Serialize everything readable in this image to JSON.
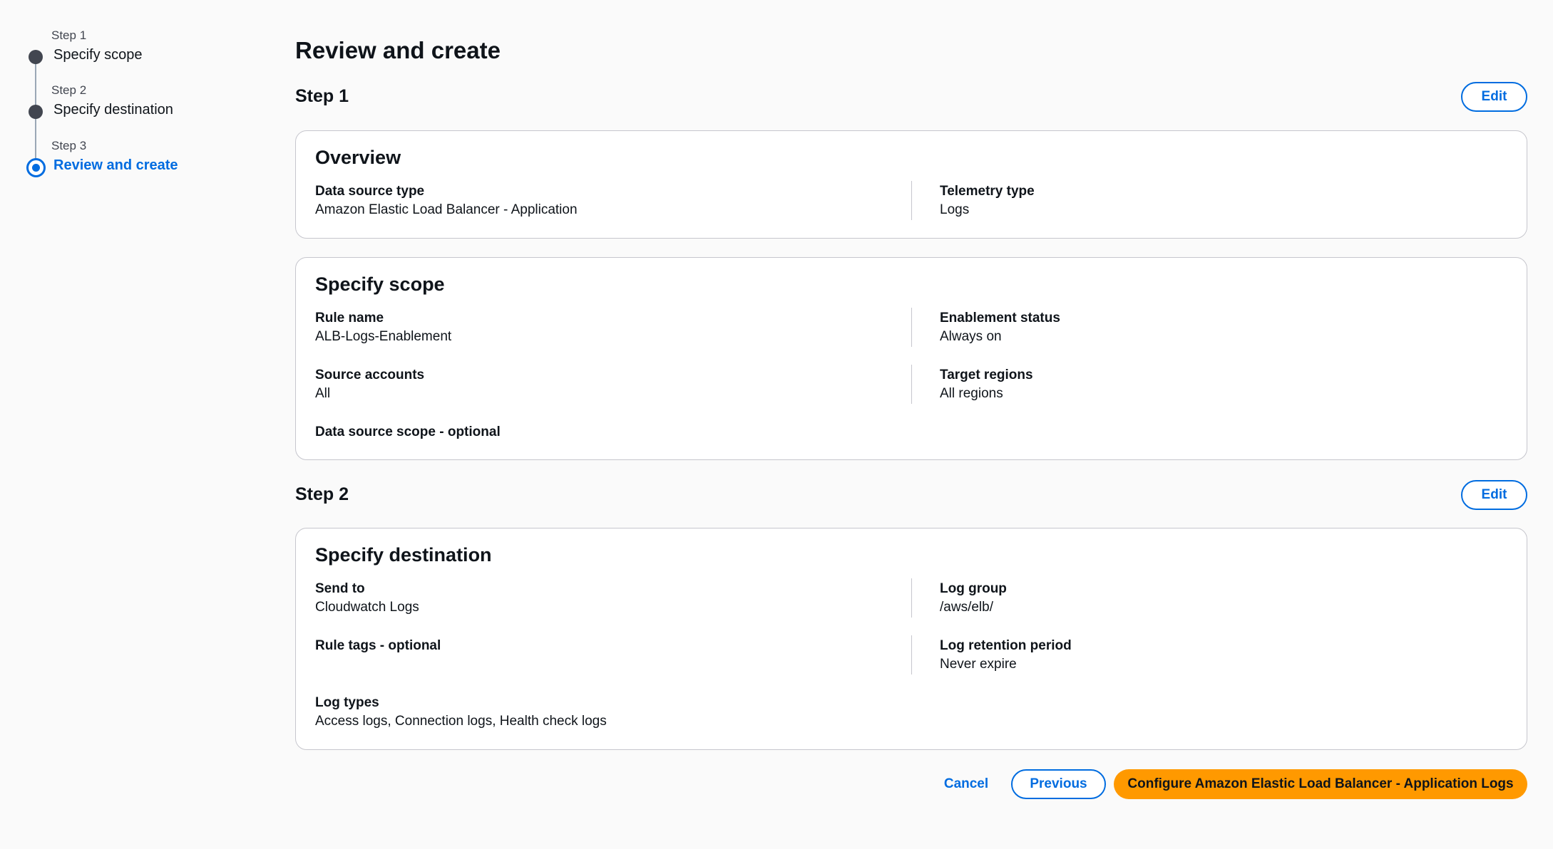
{
  "wizard": {
    "steps": [
      {
        "label": "Step 1",
        "title": "Specify scope"
      },
      {
        "label": "Step 2",
        "title": "Specify destination"
      },
      {
        "label": "Step 3",
        "title": "Review and create"
      }
    ],
    "current_step": 3
  },
  "page": {
    "title": "Review and create"
  },
  "step1": {
    "heading": "Step 1",
    "edit_label": "Edit",
    "overview": {
      "title": "Overview",
      "data_source_type_label": "Data source type",
      "data_source_type_value": "Amazon Elastic Load Balancer - Application",
      "telemetry_type_label": "Telemetry type",
      "telemetry_type_value": "Logs"
    },
    "scope": {
      "title": "Specify scope",
      "rule_name_label": "Rule name",
      "rule_name_value": "ALB-Logs-Enablement",
      "enablement_status_label": "Enablement status",
      "enablement_status_value": "Always on",
      "source_accounts_label": "Source accounts",
      "source_accounts_value": "All",
      "target_regions_label": "Target regions",
      "target_regions_value": "All regions",
      "data_source_scope_label": "Data source scope - optional"
    }
  },
  "step2": {
    "heading": "Step 2",
    "edit_label": "Edit",
    "destination": {
      "title": "Specify destination",
      "send_to_label": "Send to",
      "send_to_value": "Cloudwatch Logs",
      "log_group_label": "Log group",
      "log_group_value": "/aws/elb/",
      "rule_tags_label": "Rule tags - optional",
      "log_retention_label": "Log retention period",
      "log_retention_value": "Never expire",
      "log_types_label": "Log types",
      "log_types_value": "Access logs, Connection logs, Health check logs"
    }
  },
  "actions": {
    "cancel_label": "Cancel",
    "previous_label": "Previous",
    "submit_label": "Configure Amazon Elastic Load Balancer - Application Logs"
  },
  "colors": {
    "accent": "#006ce0",
    "primary_button": "#ff9900",
    "step_complete": "#424650"
  }
}
